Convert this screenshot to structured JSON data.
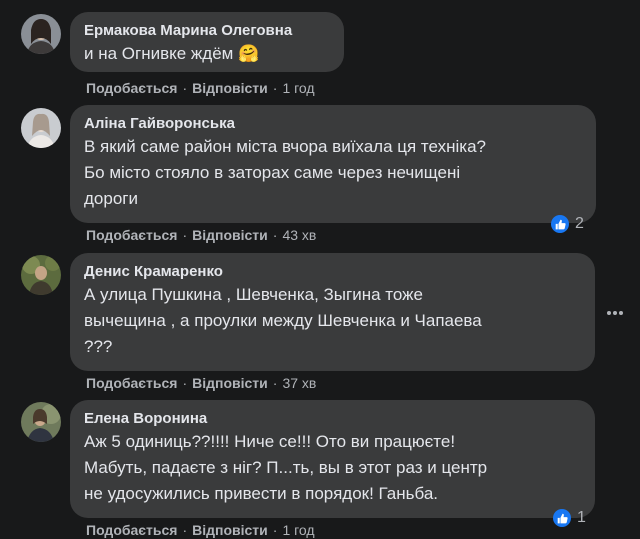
{
  "comments": [
    {
      "author": "Ермакова Марина Олеговна",
      "text": "и на Огнивке ждём 🤗",
      "like_label": "Подобається",
      "reply_label": "Відповісти",
      "time": "1 год"
    },
    {
      "author": "Аліна Гайворонська",
      "text": "В який саме район міста вчора виїхала ця техніка?\nБо місто стояло в заторах саме через нечищені\nдороги",
      "like_label": "Подобається",
      "reply_label": "Відповісти",
      "time": "43 хв",
      "reaction_count": "2"
    },
    {
      "author": "Денис Крамаренко",
      "text": "А улица Пушкина , Шевченка, Зыгина тоже\nвычещина , а проулки между Шевченка и Чапаева\n???",
      "like_label": "Подобається",
      "reply_label": "Відповісти",
      "time": "37 хв"
    },
    {
      "author": "Елена Воронина",
      "text": "Аж 5 одиниць??!!!! Ниче се!!! Ото ви працюєте!\nМабуть, падаєте з ніг? П...ть, вы в этот раз и центр\nне удосужились привести в порядок! Ганьба.",
      "like_label": "Подобається",
      "reply_label": "Відповісти",
      "time": "1 год",
      "reaction_count": "1"
    }
  ],
  "separator": "·",
  "icons": {
    "like_reaction": "thumbs-up-icon",
    "more_options": "more-options-icon"
  },
  "colors": {
    "background": "#18191a",
    "bubble": "#3a3b3c",
    "text": "#e4e6eb",
    "secondary_text": "#b0b3b8",
    "like_blue": "#1877f2"
  }
}
